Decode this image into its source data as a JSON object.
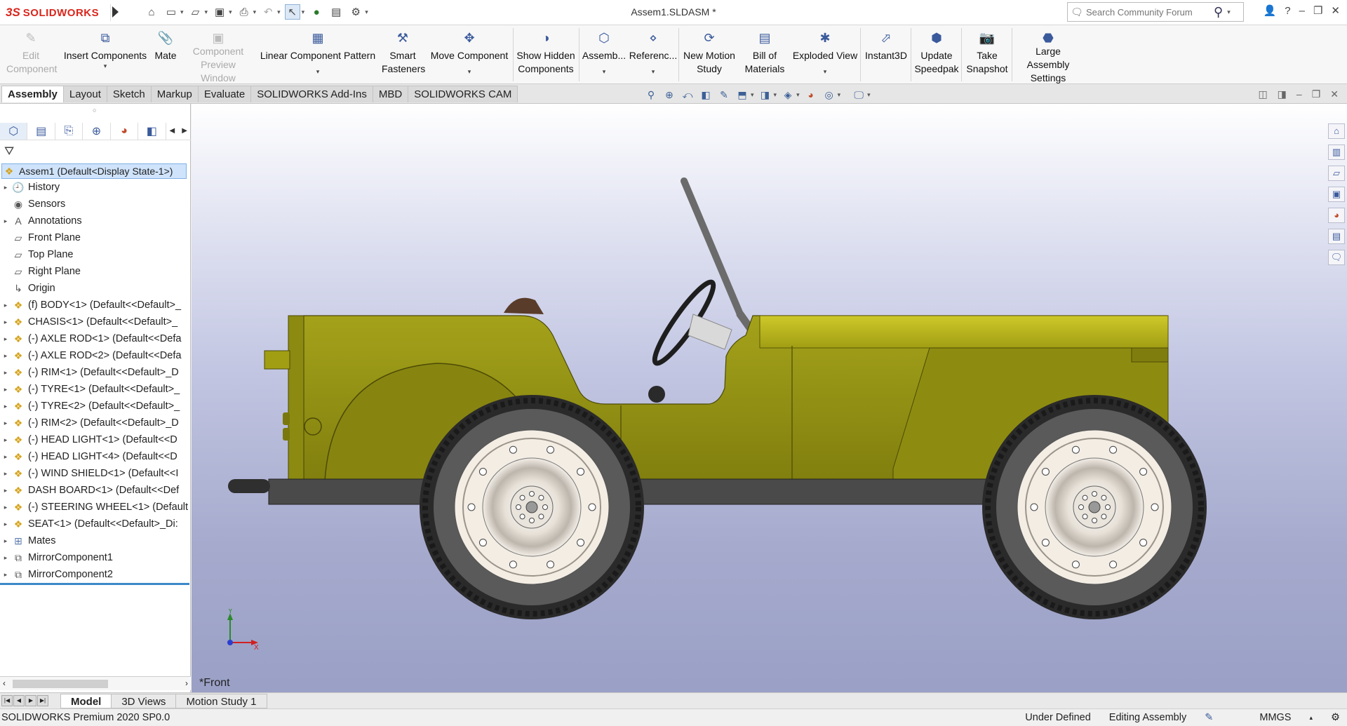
{
  "titlebar": {
    "brand_ds": "3S",
    "brand": "SOLIDWORKS",
    "document_title": "Assem1.SLDASM *",
    "search_placeholder": "Search Community Forum"
  },
  "quick_access": [
    {
      "icon": "home-icon",
      "glyph": "⌂"
    },
    {
      "icon": "new-document-icon",
      "glyph": "🗋"
    },
    {
      "icon": "open-folder-icon",
      "glyph": "📂"
    },
    {
      "icon": "save-icon",
      "glyph": "💾"
    },
    {
      "icon": "print-icon",
      "glyph": "🖶"
    },
    {
      "icon": "undo-icon",
      "glyph": "↶"
    },
    {
      "icon": "select-arrow-icon",
      "glyph": "↖"
    },
    {
      "icon": "traffic-light-icon",
      "glyph": "●"
    },
    {
      "icon": "file-properties-icon",
      "glyph": "▤"
    },
    {
      "icon": "options-gear-icon",
      "glyph": "⚙"
    }
  ],
  "command_manager": {
    "edit_component": "Edit Component",
    "insert_components": "Insert Components",
    "mate": "Mate",
    "component_preview": "Component Preview Window",
    "linear_pattern": "Linear Component Pattern",
    "smart_fasteners": "Smart Fasteners",
    "move_component": "Move Component",
    "show_hidden": "Show Hidden Components",
    "assembly_features": "Assemb...",
    "reference_geometry": "Referenc...",
    "new_motion_study": "New Motion Study",
    "bill_of_materials": "Bill of Materials",
    "exploded_view": "Exploded View",
    "instant3d": "Instant3D",
    "update_speedpak": "Update Speedpak",
    "take_snapshot": "Take Snapshot",
    "large_assembly": "Large Assembly Settings"
  },
  "tabs": [
    "Assembly",
    "Layout",
    "Sketch",
    "Markup",
    "Evaluate",
    "SOLIDWORKS Add-Ins",
    "MBD",
    "SOLIDWORKS CAM"
  ],
  "tree": {
    "root": "Assem1  (Default<Display State-1>)",
    "items": [
      {
        "label": "History",
        "icon": "history-icon",
        "glyph": "🕘",
        "expander": true,
        "kind": "plain"
      },
      {
        "label": "Sensors",
        "icon": "sensors-icon",
        "glyph": "◉",
        "expander": false,
        "kind": "plain"
      },
      {
        "label": "Annotations",
        "icon": "annotations-icon",
        "glyph": "A",
        "expander": true,
        "kind": "plain"
      },
      {
        "label": "Front Plane",
        "icon": "plane-icon",
        "glyph": "▱",
        "expander": false,
        "kind": "plain"
      },
      {
        "label": "Top Plane",
        "icon": "plane-icon",
        "glyph": "▱",
        "expander": false,
        "kind": "plain"
      },
      {
        "label": "Right Plane",
        "icon": "plane-icon",
        "glyph": "▱",
        "expander": false,
        "kind": "plain"
      },
      {
        "label": "Origin",
        "icon": "origin-icon",
        "glyph": "↳",
        "expander": false,
        "kind": "plain"
      },
      {
        "label": "(f) BODY<1> (Default<<Default>_",
        "icon": "part-icon",
        "glyph": "❖",
        "expander": true,
        "kind": "part"
      },
      {
        "label": "CHASIS<1> (Default<<Default>_",
        "icon": "part-icon",
        "glyph": "❖",
        "expander": true,
        "kind": "part"
      },
      {
        "label": "(-) AXLE ROD<1> (Default<<Defa",
        "icon": "part-icon",
        "glyph": "❖",
        "expander": true,
        "kind": "part"
      },
      {
        "label": "(-) AXLE ROD<2> (Default<<Defa",
        "icon": "part-icon",
        "glyph": "❖",
        "expander": true,
        "kind": "part"
      },
      {
        "label": "(-) RIM<1> (Default<<Default>_D",
        "icon": "part-icon",
        "glyph": "❖",
        "expander": true,
        "kind": "part"
      },
      {
        "label": "(-) TYRE<1> (Default<<Default>_",
        "icon": "part-icon",
        "glyph": "❖",
        "expander": true,
        "kind": "part"
      },
      {
        "label": "(-) TYRE<2> (Default<<Default>_",
        "icon": "part-icon",
        "glyph": "❖",
        "expander": true,
        "kind": "part"
      },
      {
        "label": "(-) RIM<2> (Default<<Default>_D",
        "icon": "part-icon",
        "glyph": "❖",
        "expander": true,
        "kind": "part"
      },
      {
        "label": "(-) HEAD LIGHT<1> (Default<<D",
        "icon": "part-icon",
        "glyph": "❖",
        "expander": true,
        "kind": "part"
      },
      {
        "label": "(-) HEAD LIGHT<4> (Default<<D",
        "icon": "part-icon",
        "glyph": "❖",
        "expander": true,
        "kind": "part"
      },
      {
        "label": "(-) WIND SHIELD<1> (Default<<I",
        "icon": "part-icon",
        "glyph": "❖",
        "expander": true,
        "kind": "part"
      },
      {
        "label": "DASH BOARD<1> (Default<<Def",
        "icon": "part-icon",
        "glyph": "❖",
        "expander": true,
        "kind": "part"
      },
      {
        "label": "(-) STEERING WHEEL<1> (Default",
        "icon": "part-icon",
        "glyph": "❖",
        "expander": true,
        "kind": "part"
      },
      {
        "label": "SEAT<1> (Default<<Default>_Di:",
        "icon": "part-icon",
        "glyph": "❖",
        "expander": true,
        "kind": "part"
      },
      {
        "label": "Mates",
        "icon": "mates-icon",
        "glyph": "⊞",
        "expander": true,
        "kind": "mates"
      },
      {
        "label": "MirrorComponent1",
        "icon": "mirror-component-icon",
        "glyph": "⧉",
        "expander": true,
        "kind": "plain"
      },
      {
        "label": "MirrorComponent2",
        "icon": "mirror-component-icon",
        "glyph": "⧉",
        "expander": true,
        "kind": "plain"
      }
    ]
  },
  "viewport": {
    "view_label": "*Front",
    "triad_x": "X",
    "triad_y": "Y"
  },
  "bottom_tabs": [
    "Model",
    "3D Views",
    "Motion Study 1"
  ],
  "status": {
    "product": "SOLIDWORKS Premium 2020 SP0.0",
    "definition": "Under Defined",
    "mode": "Editing Assembly",
    "units": "MMGS"
  },
  "colors": {
    "body": "#8c8a10",
    "body_dark": "#6f6d0c",
    "chassis": "#4b4b4b",
    "tyre": "#555555",
    "rim": "#f2ece3",
    "selection": "#cfe3fb"
  }
}
